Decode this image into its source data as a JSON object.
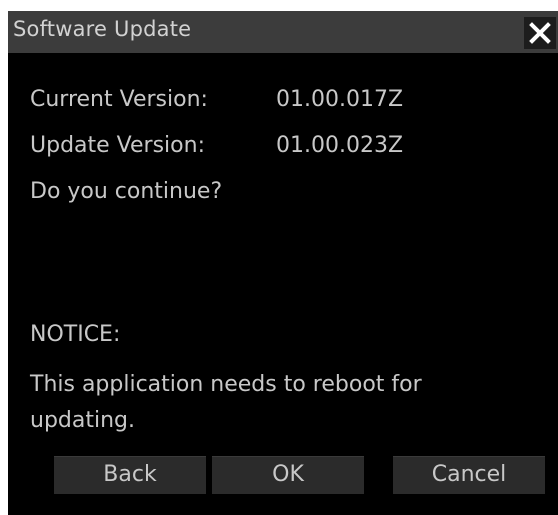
{
  "dialog": {
    "title": "Software Update",
    "close_label": "✕"
  },
  "info": {
    "current_version_label": "Current Version:",
    "current_version_value": "01.00.017Z",
    "update_version_label": "Update Version:",
    "update_version_value": "01.00.023Z",
    "prompt": "Do you continue?"
  },
  "notice": {
    "heading": "NOTICE:",
    "message": "This application needs to reboot for updating."
  },
  "buttons": {
    "back": "Back",
    "ok": "OK",
    "cancel": "Cancel"
  }
}
